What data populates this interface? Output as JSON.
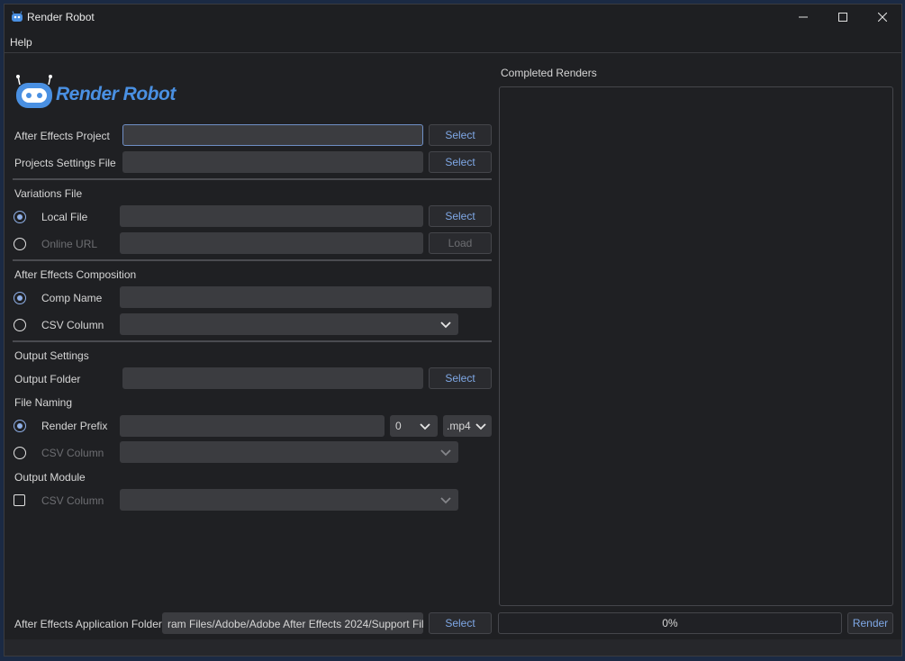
{
  "window": {
    "title": "Render Robot",
    "controls": [
      "minimize-icon",
      "maximize-icon",
      "close-icon"
    ]
  },
  "menu": {
    "items": [
      "Help"
    ]
  },
  "logo": {
    "text": "Render Robot",
    "colors": {
      "primary": "#4a90e2"
    }
  },
  "project": {
    "ae_project_label": "After Effects Project",
    "ae_project_value": "",
    "settings_label": "Projects Settings File",
    "settings_value": "",
    "select_label": "Select"
  },
  "variations": {
    "heading": "Variations File",
    "local_label": "Local File",
    "local_value": "",
    "online_label": "Online URL",
    "online_value": "",
    "select_label": "Select",
    "load_label": "Load",
    "selected": "local"
  },
  "composition": {
    "heading": "After Effects Composition",
    "comp_name_label": "Comp Name",
    "comp_name_value": "",
    "csv_label": "CSV Column",
    "csv_value": "",
    "selected": "comp_name"
  },
  "output": {
    "heading": "Output Settings",
    "folder_label": "Output Folder",
    "folder_value": "",
    "select_label": "Select",
    "naming_heading": "File Naming",
    "prefix_label": "Render Prefix",
    "prefix_value": "",
    "padding_value": "0",
    "extension_value": ".mp4",
    "csv_label": "CSV Column",
    "naming_selected": "prefix",
    "module_heading": "Output Module",
    "module_csv_label": "CSV Column",
    "module_checked": false
  },
  "completed": {
    "heading": "Completed Renders"
  },
  "footer": {
    "app_folder_label": "After Effects Application Folder",
    "app_folder_value": "ram Files/Adobe/Adobe After Effects 2024/Support Files",
    "select_label": "Select",
    "progress_text": "0%",
    "progress_value": 0,
    "render_label": "Render"
  }
}
